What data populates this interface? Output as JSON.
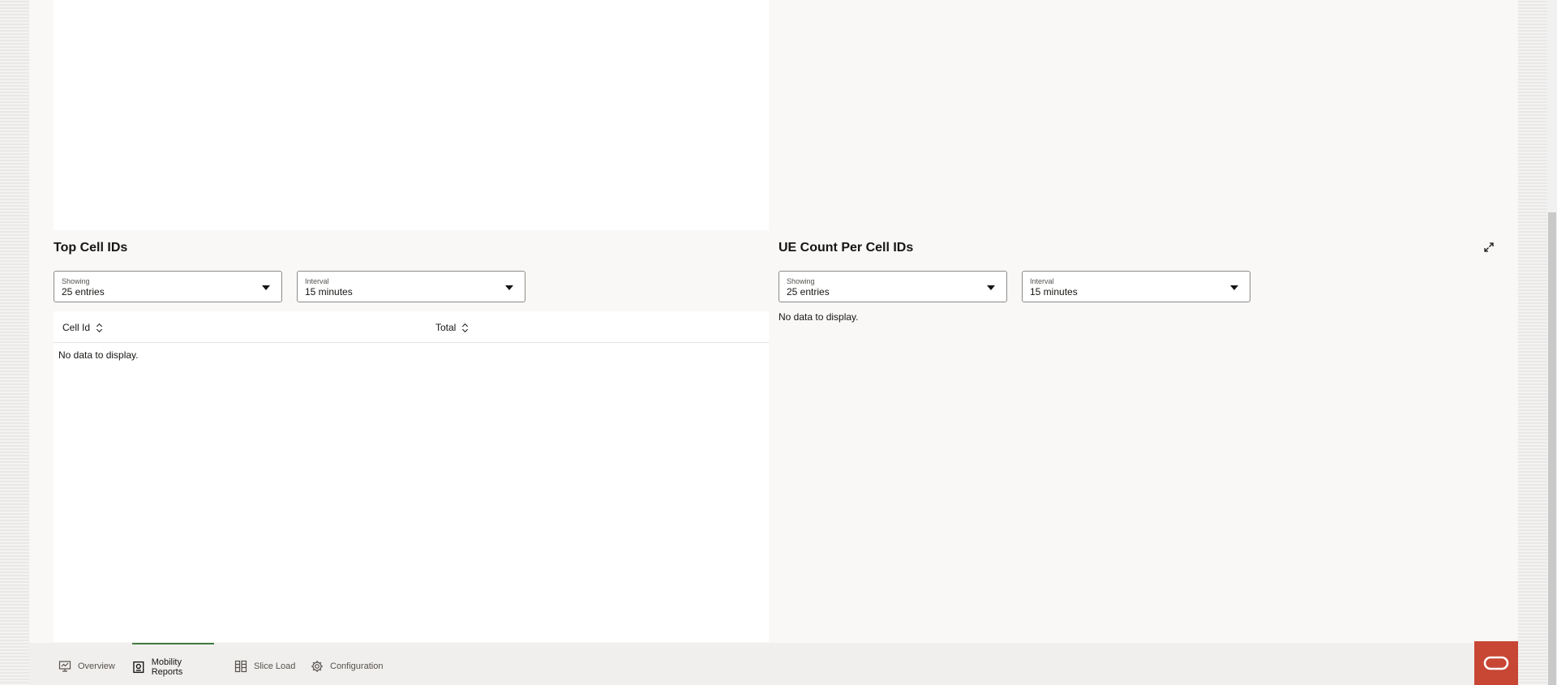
{
  "left_panel": {
    "title": "Top Cell IDs",
    "showing": {
      "label": "Showing",
      "value": "25 entries"
    },
    "interval": {
      "label": "Interval",
      "value": "15 minutes"
    },
    "table": {
      "columns": [
        "Cell Id",
        "Total"
      ],
      "empty_message": "No data to display."
    }
  },
  "right_panel": {
    "title": "UE Count Per Cell IDs",
    "showing": {
      "label": "Showing",
      "value": "25 entries"
    },
    "interval": {
      "label": "Interval",
      "value": "15 minutes"
    },
    "empty_message": "No data to display."
  },
  "nav": {
    "tabs": [
      {
        "label": "Overview",
        "icon": "monitor-icon",
        "active": false
      },
      {
        "label": "Mobility Reports",
        "icon": "report-icon",
        "active": true
      },
      {
        "label": "Slice Load",
        "icon": "slice-icon",
        "active": false
      },
      {
        "label": "Configuration",
        "icon": "gear-icon",
        "active": false
      }
    ]
  },
  "colors": {
    "accent_active": "#3d7a3f",
    "brand": "#c74634"
  }
}
